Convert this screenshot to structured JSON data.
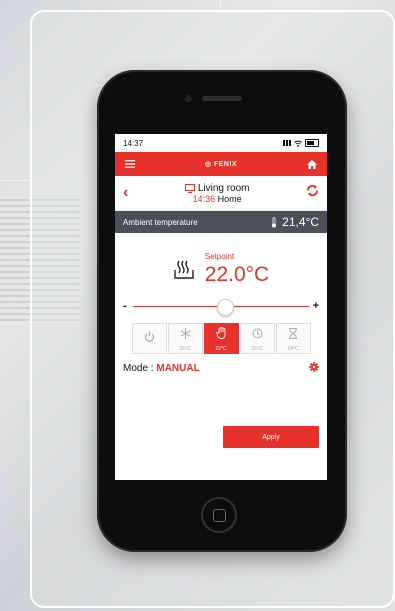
{
  "status": {
    "time": "14:37"
  },
  "topbar": {
    "brand": "FENIX",
    "menu_icon": "menu-icon",
    "home_icon": "home-icon"
  },
  "room": {
    "name": "Living room",
    "time": "14:36",
    "mode": "Home"
  },
  "ambient": {
    "label": "Ambient temperature",
    "value": "21,4°C"
  },
  "setpoint": {
    "label": "Setpoint",
    "value": "22.0°C"
  },
  "slider": {
    "minus": "-",
    "plus": "+",
    "level_fraction": 0.52
  },
  "modes": [
    {
      "name": "off",
      "icon": "power-icon",
      "temp": ""
    },
    {
      "name": "frost",
      "icon": "snowflake-icon",
      "temp": "16°C"
    },
    {
      "name": "manual",
      "icon": "hand-icon",
      "temp": "22°C",
      "active": true
    },
    {
      "name": "schedule",
      "icon": "clock-icon",
      "temp": "16°C"
    },
    {
      "name": "timer",
      "icon": "hourglass-icon",
      "temp": "24°C"
    }
  ],
  "mode_info": {
    "label": "Mode : ",
    "value": "MANUAL"
  },
  "apply": {
    "label": "Apply"
  },
  "colors": {
    "accent": "#e6322b",
    "ambient_bar": "#4b5157"
  }
}
